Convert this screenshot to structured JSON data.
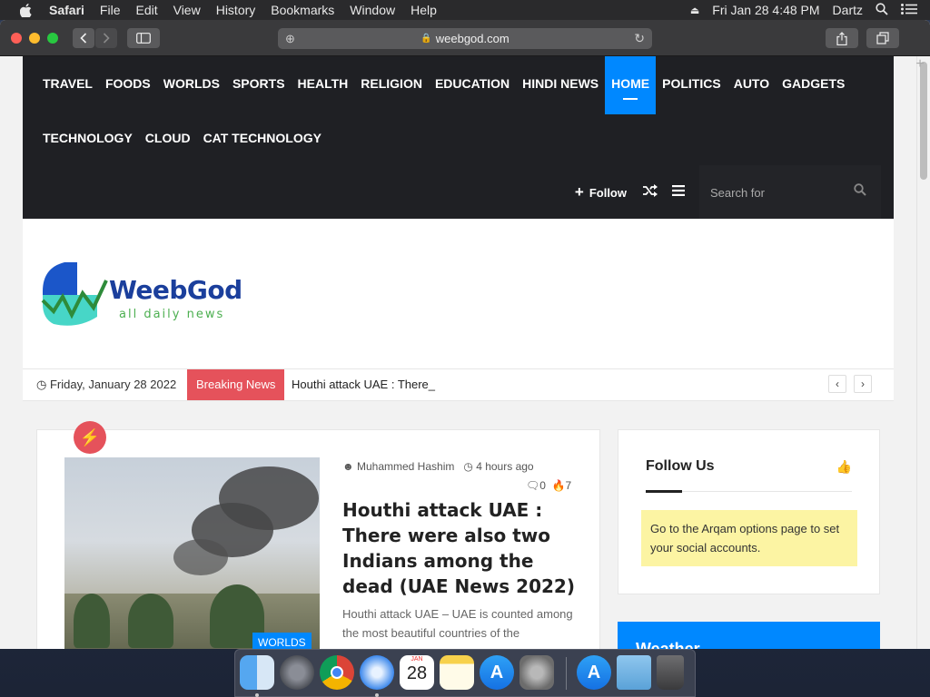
{
  "menubar": {
    "app": "Safari",
    "items": [
      "File",
      "Edit",
      "View",
      "History",
      "Bookmarks",
      "Window",
      "Help"
    ],
    "datetime": "Fri Jan 28  4:48 PM",
    "user": "Dartz"
  },
  "browser": {
    "url": "weebgod.com"
  },
  "site": {
    "nav_row1": [
      "TRAVEL",
      "FOODS",
      "WORLDS",
      "SPORTS",
      "HEALTH",
      "RELIGION",
      "EDUCATION",
      "HINDI NEWS",
      "HOME",
      "POLITICS",
      "AUTO",
      "GADGETS"
    ],
    "nav_row2": [
      "TECHNOLOGY",
      "CLOUD",
      "CAT TECHNOLOGY"
    ],
    "active_nav": "HOME",
    "follow_label": "Follow",
    "search_placeholder": "Search for",
    "logo_name": "WeebGod",
    "logo_tagline": "all daily news",
    "date": "Friday, January 28 2022",
    "breaking_label": "Breaking News",
    "breaking_text": "Houthi attack UAE : There_",
    "post": {
      "author": "Muhammed Hashim",
      "time": "4 hours ago",
      "comments": "0",
      "views": "7",
      "title": "Houthi attack UAE : There were also two Indians among the dead (UAE News 2022)",
      "excerpt": "Houthi attack UAE – UAE is counted among the most beautiful countries of the",
      "category": "WORLDS"
    },
    "sidebar": {
      "follow_title": "Follow Us",
      "follow_note": "Go to the Arqam options page to set your social accounts.",
      "weather_title": "Weather"
    }
  },
  "colors": {
    "accent": "#0088ff",
    "breaking": "#e5525b",
    "nav_bg": "#1f2024",
    "note_bg": "#fcf4a3"
  },
  "dock": {
    "calendar_month": "JAN",
    "calendar_day": "28",
    "apps": [
      "finder-icon",
      "launchpad-icon",
      "chrome-icon",
      "safari-icon",
      "calendar-icon",
      "notes-icon",
      "app-store-icon",
      "system-preferences-icon",
      "app-store-icon",
      "downloads-folder-icon",
      "trash-icon"
    ]
  }
}
